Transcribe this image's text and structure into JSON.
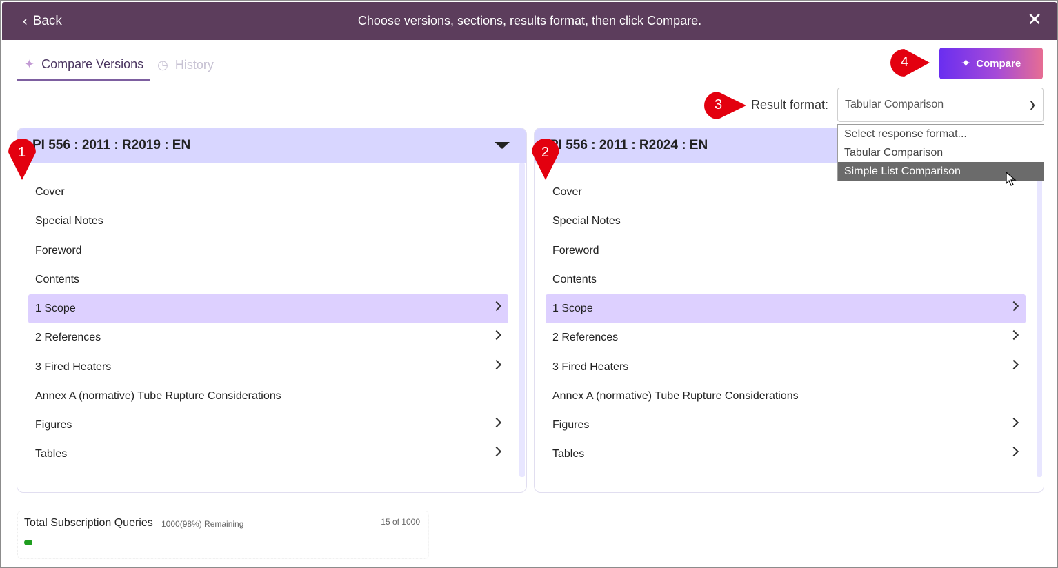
{
  "header": {
    "back_label": "Back",
    "title": "Choose versions, sections, results format, then click Compare.",
    "close_icon": "close-icon",
    "bg_color": "#5c3d5c"
  },
  "tabs": [
    {
      "label": "Compare Versions",
      "icon": "sparkle-icon",
      "active": true
    },
    {
      "label": "History",
      "icon": "clock-icon",
      "active": false
    }
  ],
  "compare_button": {
    "label": "Compare",
    "icon": "sparkle-icon"
  },
  "result_format": {
    "label": "Result format:",
    "selected": "Tabular Comparison",
    "options": [
      "Select response format...",
      "Tabular Comparison",
      "Simple List Comparison"
    ],
    "highlighted": "Simple List Comparison"
  },
  "markers": [
    "1",
    "2",
    "3",
    "4"
  ],
  "left_panel": {
    "title": "PI 556 : 2011 : R2019 : EN",
    "items": [
      {
        "label": "Cover",
        "has_children": false
      },
      {
        "label": "Special Notes",
        "has_children": false
      },
      {
        "label": "Foreword",
        "has_children": false
      },
      {
        "label": "Contents",
        "has_children": false
      },
      {
        "label": "1 Scope",
        "has_children": true,
        "selected": true
      },
      {
        "label": "2 References",
        "has_children": true
      },
      {
        "label": "3 Fired Heaters",
        "has_children": true
      },
      {
        "label": "Annex A (normative) Tube Rupture Considerations",
        "has_children": false
      },
      {
        "label": "Figures",
        "has_children": true
      },
      {
        "label": "Tables",
        "has_children": true
      }
    ]
  },
  "right_panel": {
    "title": "PI 556 : 2011 : R2024 : EN",
    "items": [
      {
        "label": "Cover",
        "has_children": false
      },
      {
        "label": "Special Notes",
        "has_children": false
      },
      {
        "label": "Foreword",
        "has_children": false
      },
      {
        "label": "Contents",
        "has_children": false
      },
      {
        "label": "1 Scope",
        "has_children": true,
        "selected": true
      },
      {
        "label": "2 References",
        "has_children": true
      },
      {
        "label": "3 Fired Heaters",
        "has_children": true
      },
      {
        "label": "Annex A (normative) Tube Rupture Considerations",
        "has_children": false
      },
      {
        "label": "Figures",
        "has_children": true
      },
      {
        "label": "Tables",
        "has_children": true
      }
    ]
  },
  "usage": {
    "title": "Total Subscription Queries",
    "remaining": "1000(98%) Remaining",
    "count": "15 of 1000",
    "fill_fraction": 0.015,
    "fill_color": "#1f9d1f"
  }
}
